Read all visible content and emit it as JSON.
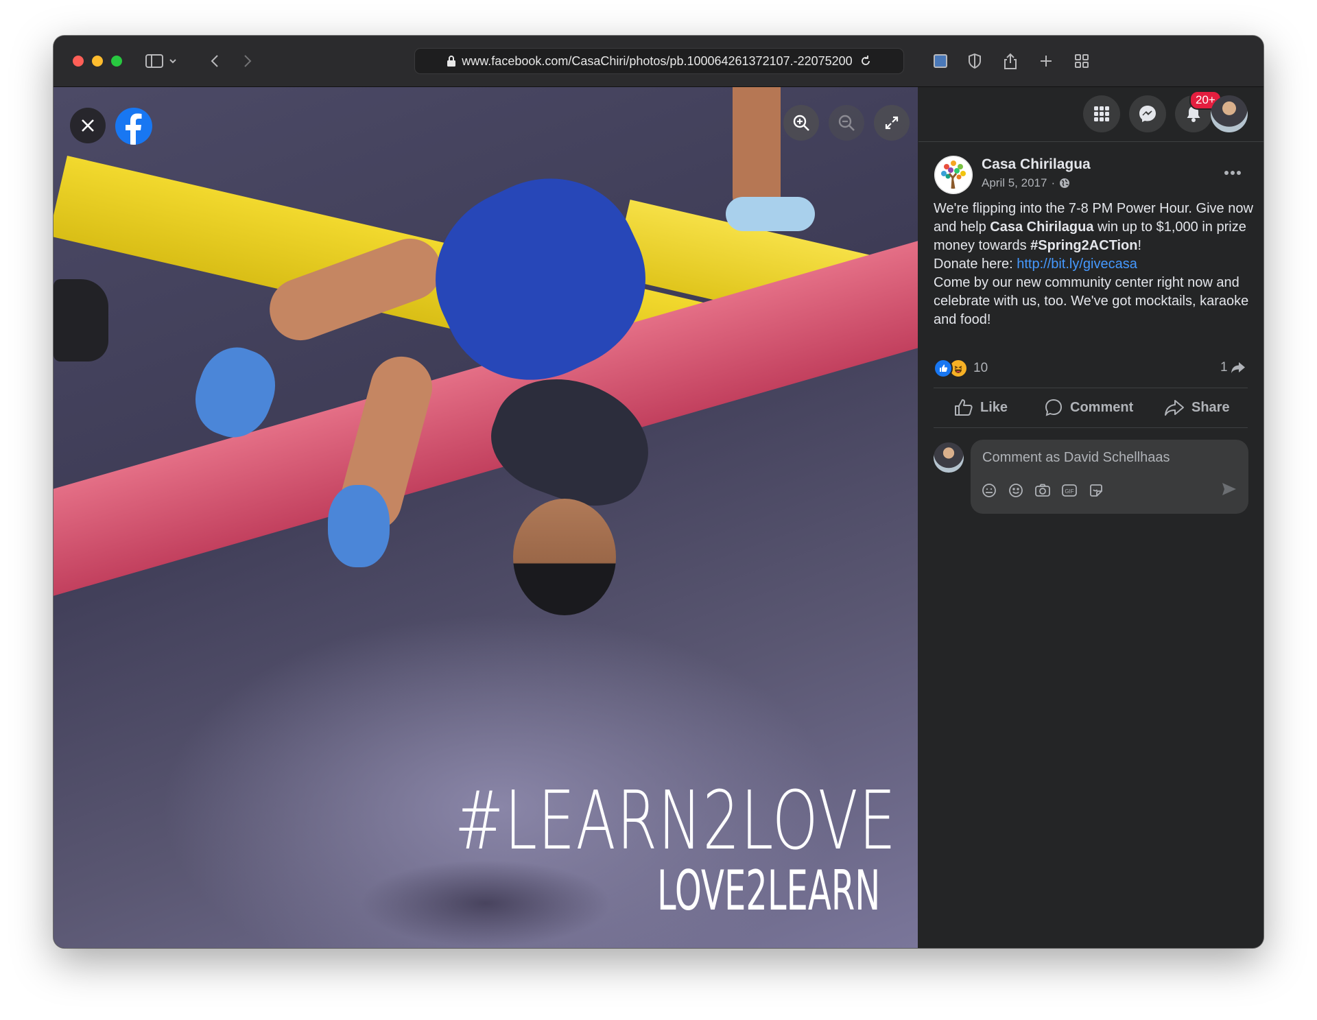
{
  "browser": {
    "url": "www.facebook.com/CasaChiri/photos/pb.100064261372107.-22075200"
  },
  "photo": {
    "overlay_main": "#LEARN2LOVE",
    "overlay_sub": "LOVE2LEARN"
  },
  "header": {
    "notification_badge": "20+"
  },
  "post": {
    "page_name": "Casa Chirilagua",
    "date": "April 5, 2017",
    "date_separator": "·",
    "text_1": "We're flipping into the 7-8 PM Power Hour. Give now and help ",
    "text_bold_page": "Casa Chirilagua",
    "text_2": " win up to $1,000 in prize money towards ",
    "text_hashtag": "#Spring2ACTion",
    "text_3": "!",
    "text_donate": "Donate here: ",
    "link": "http://bit.ly/givecasa",
    "text_4": "Come by our new community center right now and celebrate with us, too. We've got mocktails, karaoke and food!",
    "reaction_count": "10",
    "share_count": "1"
  },
  "actions": {
    "like": "Like",
    "comment": "Comment",
    "share": "Share"
  },
  "composer": {
    "placeholder": "Comment as David Schellhaas"
  },
  "colors": {
    "facebook_blue": "#1877f2",
    "badge_red": "#e41e3f",
    "link_blue": "#4599ff",
    "sidebar_bg": "#242526"
  }
}
